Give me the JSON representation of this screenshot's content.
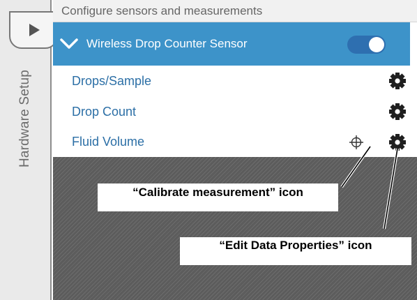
{
  "rail": {
    "expand_icon": "play-triangle-icon",
    "tab_label": "Hardware Setup"
  },
  "header": {
    "title": "Configure sensors and measurements"
  },
  "sensor": {
    "name": "Wireless Drop Counter Sensor",
    "expanded": true,
    "enabled": true,
    "chevron_icon": "chevron-down-icon"
  },
  "measurements": [
    {
      "label": "Drops/Sample",
      "calibratable": false,
      "settings_icon": "gear-icon"
    },
    {
      "label": "Drop Count",
      "calibratable": false,
      "settings_icon": "gear-icon"
    },
    {
      "label": "Fluid Volume",
      "calibratable": true,
      "calibrate_icon": "crosshair-icon",
      "settings_icon": "gear-icon"
    }
  ],
  "annotations": {
    "calibrate": "“Calibrate measurement” icon",
    "edit": "“Edit Data Properties” icon"
  },
  "colors": {
    "accent": "#3d93c9",
    "toggle": "#2e6fb0",
    "link_text": "#2c6fa6",
    "background_hatch": "#5c5c5c"
  }
}
